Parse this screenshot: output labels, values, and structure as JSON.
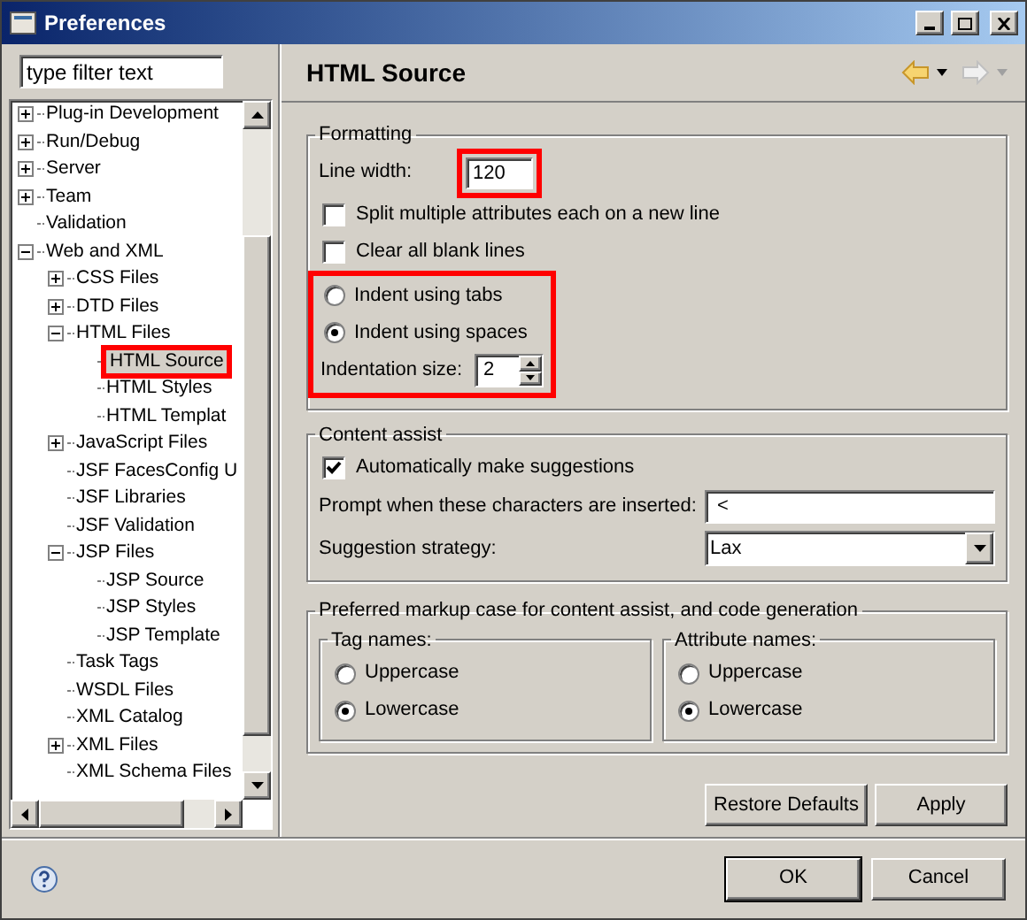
{
  "window": {
    "title": "Preferences"
  },
  "filter": {
    "value": "type filter text"
  },
  "tree": [
    {
      "label": "Plug-in Development",
      "expanded": false,
      "selected": false
    },
    {
      "label": "Run/Debug",
      "expanded": false,
      "selected": false
    },
    {
      "label": "Server",
      "expanded": false,
      "selected": false
    },
    {
      "label": "Team",
      "expanded": false,
      "selected": false
    },
    {
      "label": "Validation",
      "selected": false
    },
    {
      "label": "Web and XML",
      "expanded": true,
      "selected": false,
      "children": [
        {
          "label": "CSS Files",
          "expanded": false,
          "selected": false
        },
        {
          "label": "DTD Files",
          "expanded": false,
          "selected": false
        },
        {
          "label": "HTML Files",
          "expanded": true,
          "selected": false,
          "children": [
            {
              "label": "HTML Source",
              "selected": true,
              "highlighted": true
            },
            {
              "label": "HTML Styles",
              "selected": false
            },
            {
              "label": "HTML Templat",
              "selected": false
            }
          ]
        },
        {
          "label": "JavaScript Files",
          "expanded": false,
          "selected": false
        },
        {
          "label": "JSF FacesConfig U",
          "selected": false
        },
        {
          "label": "JSF Libraries",
          "selected": false
        },
        {
          "label": "JSF Validation",
          "selected": false
        },
        {
          "label": "JSP Files",
          "expanded": true,
          "selected": false,
          "children": [
            {
              "label": "JSP Source",
              "selected": false
            },
            {
              "label": "JSP Styles",
              "selected": false
            },
            {
              "label": "JSP Template",
              "selected": false
            }
          ]
        },
        {
          "label": "Task Tags",
          "selected": false
        },
        {
          "label": "WSDL Files",
          "selected": false
        },
        {
          "label": "XML Catalog",
          "selected": false
        },
        {
          "label": "XML Files",
          "expanded": false,
          "selected": false
        },
        {
          "label": "XML Schema Files",
          "selected": false
        }
      ]
    }
  ],
  "page": {
    "title": "HTML Source"
  },
  "formatting": {
    "title": "Formatting",
    "line_width": {
      "label": "Line width:",
      "value": "120",
      "highlighted": true
    },
    "checkboxes": [
      {
        "label": "Split multiple attributes each on a new line",
        "checked": false
      },
      {
        "label": "Clear all blank lines",
        "checked": false
      }
    ],
    "indent": {
      "highlighted": true,
      "options": [
        {
          "label": "Indent using tabs",
          "selected": false
        },
        {
          "label": "Indent using spaces",
          "selected": true
        }
      ],
      "size": {
        "label": "Indentation size:",
        "value": "2"
      }
    }
  },
  "content_assist": {
    "title": "Content assist",
    "auto": {
      "label": "Automatically make suggestions",
      "checked": true
    },
    "prompt": {
      "label": "Prompt when these characters are inserted:",
      "value": "<"
    },
    "strategy": {
      "label": "Suggestion strategy:",
      "value": "Lax"
    }
  },
  "markup_case": {
    "title": "Preferred markup case for content assist, and code generation",
    "groups": [
      {
        "title": "Tag names:",
        "options": [
          {
            "label": "Uppercase",
            "selected": false
          },
          {
            "label": "Lowercase",
            "selected": true
          }
        ]
      },
      {
        "title": "Attribute names:",
        "options": [
          {
            "label": "Uppercase",
            "selected": false
          },
          {
            "label": "Lowercase",
            "selected": true
          }
        ]
      }
    ]
  },
  "page_buttons": [
    "Restore Defaults",
    "Apply"
  ],
  "dialog_buttons": [
    "OK",
    "Cancel"
  ]
}
